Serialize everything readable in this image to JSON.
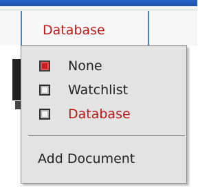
{
  "toolbar": {
    "tab_label": "Database",
    "accent_color": "#c01818",
    "separator_color": "#4a82c3"
  },
  "menu": {
    "items": [
      {
        "label": "None",
        "checked": true,
        "icon": "checkbox-checked-icon"
      },
      {
        "label": "Watchlist",
        "checked": false,
        "icon": "checkbox-empty-icon"
      },
      {
        "label": "Database",
        "checked": false,
        "icon": "checkbox-empty-icon"
      }
    ],
    "action_label": "Add Document"
  }
}
